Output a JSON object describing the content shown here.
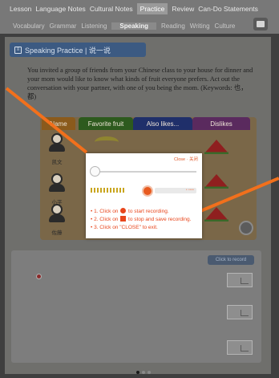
{
  "nav": {
    "tabs": [
      "Lesson",
      "Language Notes",
      "Cultural Notes",
      "Practice",
      "Review",
      "Can-Do Statements"
    ],
    "subtabs": [
      "Vocabulary",
      "Grammar",
      "Listening",
      "Speaking",
      "Reading",
      "Writing",
      "Culture"
    ],
    "active_tab": "Practice",
    "active_subtab": "Speaking"
  },
  "title": "Speaking Practice | 说一说",
  "instruction": "You invited a group of friends from your Chinese class to your house for dinner and your mom would like to know what kinds of fruit everyone prefers. Act out the conversation with your partner, with one of you being the mom. (Keywords: 也，都)",
  "table_headers": [
    "Name",
    "Favorite fruit",
    "Also likes...",
    "Dislikes"
  ],
  "names": [
    "凯文",
    "小平",
    "佐藤"
  ],
  "recorder": {
    "close": "Close · 关闭",
    "steps": [
      {
        "before": "1. Click on ",
        "icon": "circle",
        "after": " to start recording."
      },
      {
        "before": "2. Click on ",
        "icon": "square",
        "after": " to stop and save recording."
      },
      {
        "before": "3. Click on \"CLOSE\" to exit.",
        "icon": "",
        "after": ""
      }
    ],
    "levels": 11
  },
  "lower_panel": {
    "button": "Click to record"
  },
  "colors": {
    "accent": "#f2701c",
    "record": "#e8461c"
  }
}
